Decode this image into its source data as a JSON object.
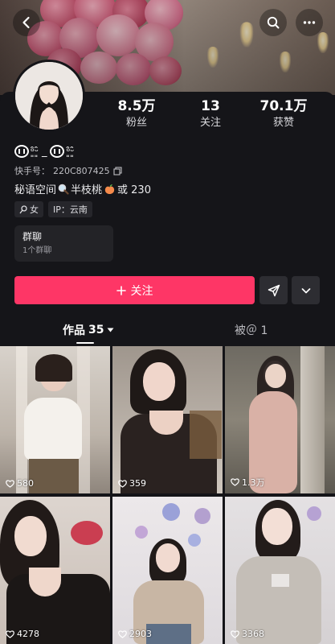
{
  "profile": {
    "nickname_badge": "ᵒ͈̑ᵕ͈̑",
    "nickname_sep": "_",
    "kuaishou_label": "快手号：",
    "kuaishou_id": "220C807425",
    "bio_part1": "秘语空间",
    "bio_part2": "半枝桃",
    "bio_part3": "或 230",
    "gender_tag": "女",
    "ip_tag": "IP：云南"
  },
  "stats": [
    {
      "num": "8.5万",
      "label": "粉丝"
    },
    {
      "num": "13",
      "label": "关注"
    },
    {
      "num": "70.1万",
      "label": "获赞"
    }
  ],
  "group": {
    "title": "群聊",
    "subtitle": "1个群聊"
  },
  "actions": {
    "follow": "关注"
  },
  "tabs": {
    "works_label": "作品",
    "works_count": "35",
    "mentioned": "被＠ 1"
  },
  "videos": [
    {
      "likes": "580"
    },
    {
      "likes": "359"
    },
    {
      "likes": "1.3万"
    },
    {
      "likes": "4278"
    },
    {
      "likes": "2903"
    },
    {
      "likes": "3368"
    }
  ],
  "colors": {
    "accent": "#fe3666",
    "background": "#151519"
  },
  "icons": [
    "back-icon",
    "search-icon",
    "more-icon",
    "copy-icon",
    "magnifier-emoji-icon",
    "peach-emoji-icon",
    "female-icon",
    "plus-icon",
    "share-icon",
    "chevron-down-icon",
    "heart-icon"
  ]
}
